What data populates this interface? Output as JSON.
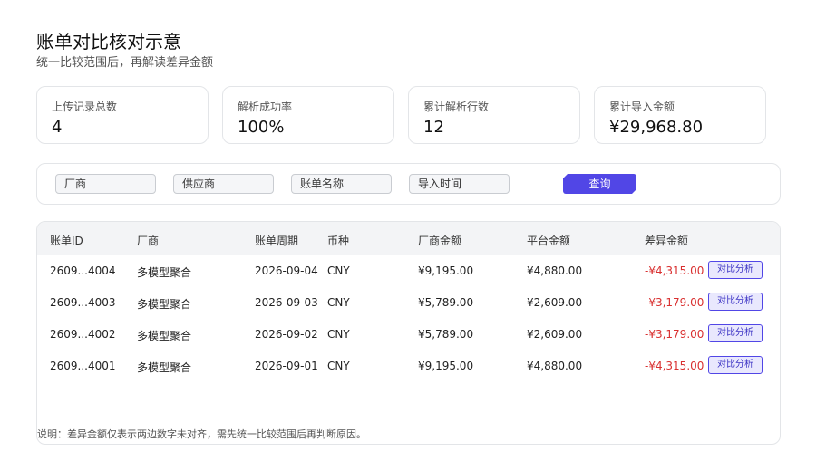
{
  "header": {
    "title": "账单对比核对示意",
    "subtitle": "统一比较范围后，再解读差异金额"
  },
  "stats": [
    {
      "label": "上传记录总数",
      "value": "4"
    },
    {
      "label": "解析成功率",
      "value": "100%"
    },
    {
      "label": "累计解析行数",
      "value": "12"
    },
    {
      "label": "累计导入金额",
      "value": "¥29,968.80"
    }
  ],
  "filters": {
    "vendor": "厂商",
    "supplier": "供应商",
    "bill_name": "账单名称",
    "import_time": "导入时间",
    "query_label": "查询"
  },
  "table": {
    "columns": [
      "账单ID",
      "厂商",
      "账单周期",
      "币种",
      "厂商金额",
      "平台金额",
      "差异金额"
    ],
    "rows": [
      {
        "id": "2609...4004",
        "vendor": "多模型聚合",
        "period": "2026-09-04",
        "currency": "CNY",
        "vendor_amount": "¥9,195.00",
        "platform_amount": "¥4,880.00",
        "diff": "-¥4,315.00",
        "action": "对比分析"
      },
      {
        "id": "2609...4003",
        "vendor": "多模型聚合",
        "period": "2026-09-03",
        "currency": "CNY",
        "vendor_amount": "¥5,789.00",
        "platform_amount": "¥2,609.00",
        "diff": "-¥3,179.00",
        "action": "对比分析"
      },
      {
        "id": "2609...4002",
        "vendor": "多模型聚合",
        "period": "2026-09-02",
        "currency": "CNY",
        "vendor_amount": "¥5,789.00",
        "platform_amount": "¥2,609.00",
        "diff": "-¥3,179.00",
        "action": "对比分析"
      },
      {
        "id": "2609...4001",
        "vendor": "多模型聚合",
        "period": "2026-09-01",
        "currency": "CNY",
        "vendor_amount": "¥9,195.00",
        "platform_amount": "¥4,880.00",
        "diff": "-¥4,315.00",
        "action": "对比分析"
      }
    ],
    "footnote": "说明：差异金额仅表示两边数字未对齐，需先统一比较范围后再判断原因。"
  },
  "colors": {
    "accent": "#5146e6",
    "diff_negative": "#d93030"
  }
}
